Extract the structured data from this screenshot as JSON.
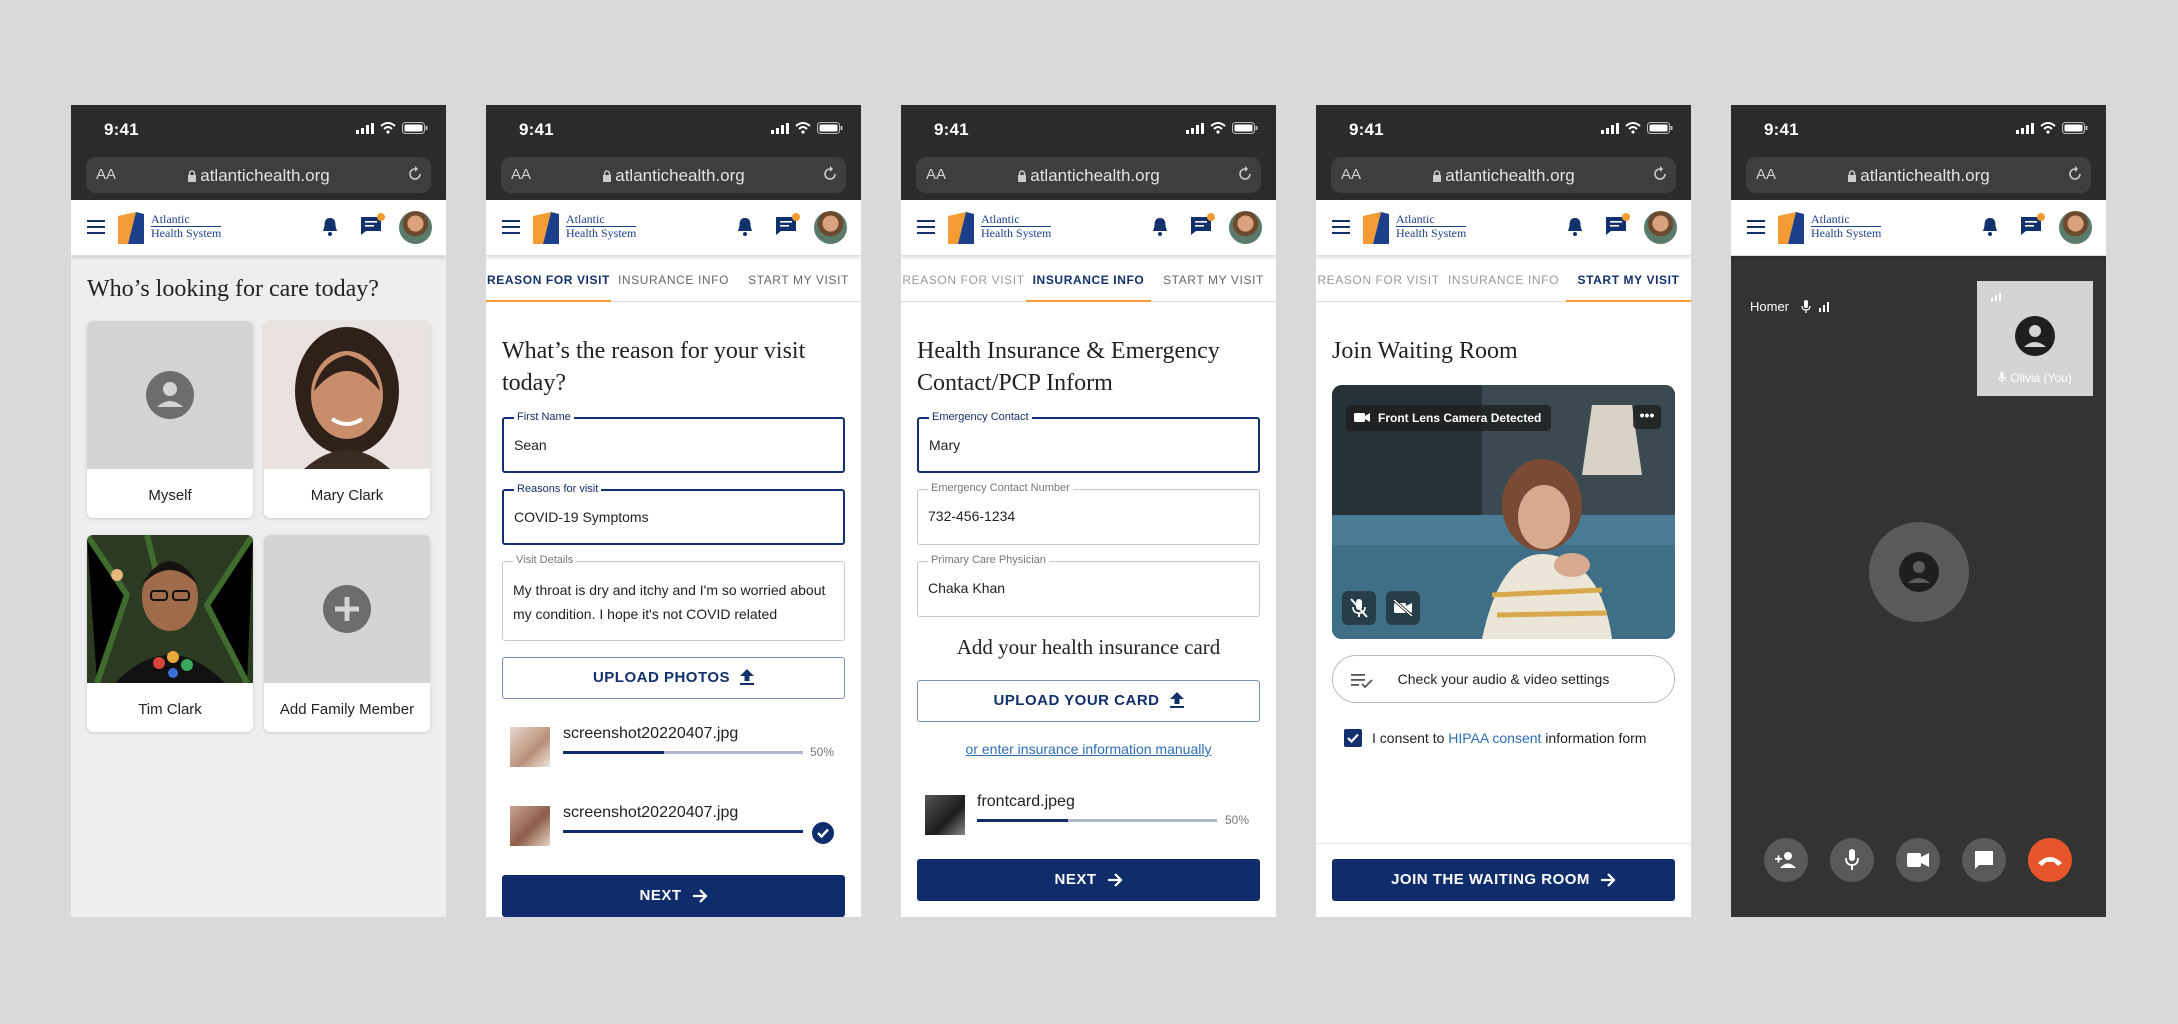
{
  "common": {
    "time": "9:41",
    "url": "atlantichealth.org",
    "aa": "AA",
    "brand_line1": "Atlantic",
    "brand_line2": "Health System"
  },
  "tabs": {
    "reason": "REASON FOR VISIT",
    "insurance": "INSURANCE INFO",
    "start": "START MY VISIT"
  },
  "screen1": {
    "title": "Who’s looking for care today?",
    "cards": [
      "Myself",
      "Mary Clark",
      "Tim Clark",
      "Add Family Member"
    ]
  },
  "screen2": {
    "title": "What’s the reason for your visit today?",
    "first_name_label": "First Name",
    "first_name_value": "Sean",
    "reasons_label": "Reasons for visit",
    "reasons_value": "COVID-19 Symptoms",
    "details_label": "Visit Details",
    "details_value": "My throat is dry and itchy and I'm so worried about my condition. I hope it's not COVID related",
    "upload_label": "UPLOAD PHOTOS",
    "files": [
      {
        "name": "screenshot20220407.jpg",
        "pct": "50%",
        "progress": 0.42
      },
      {
        "name": "screenshot20220407.jpg",
        "pct": "",
        "progress": 1.0
      }
    ],
    "next_label": "NEXT"
  },
  "screen3": {
    "title": "Health Insurance & Emergency Contact/PCP Inform",
    "emergency_label": "Emergency Contact",
    "emergency_value": "Mary",
    "number_label": "Emergency Contact Number",
    "number_value": "732-456-1234",
    "pcp_label": "Primary Care Physician",
    "pcp_value": "Chaka Khan",
    "card_heading": "Add your health insurance card",
    "upload_label": "UPLOAD YOUR CARD",
    "manual_link": "or enter insurance information manually",
    "file": {
      "name": "frontcard.jpeg",
      "pct": "50%",
      "progress": 0.38
    },
    "next_label": "NEXT"
  },
  "screen4": {
    "title": "Join Waiting Room",
    "camera_label": "Front Lens Camera Detected",
    "settings_label": "Check your audio & video settings",
    "consent_prefix": "I consent to ",
    "consent_link": "HIPAA consent",
    "consent_suffix": " information form",
    "join_label": "JOIN THE WAITING ROOM"
  },
  "screen5": {
    "participant": "Homer",
    "self_label": "Olivia (You)"
  },
  "colors": {
    "navy": "#0f2d6b",
    "orange": "#f39c34",
    "end_call": "#e8552a",
    "link": "#2f6db5"
  }
}
